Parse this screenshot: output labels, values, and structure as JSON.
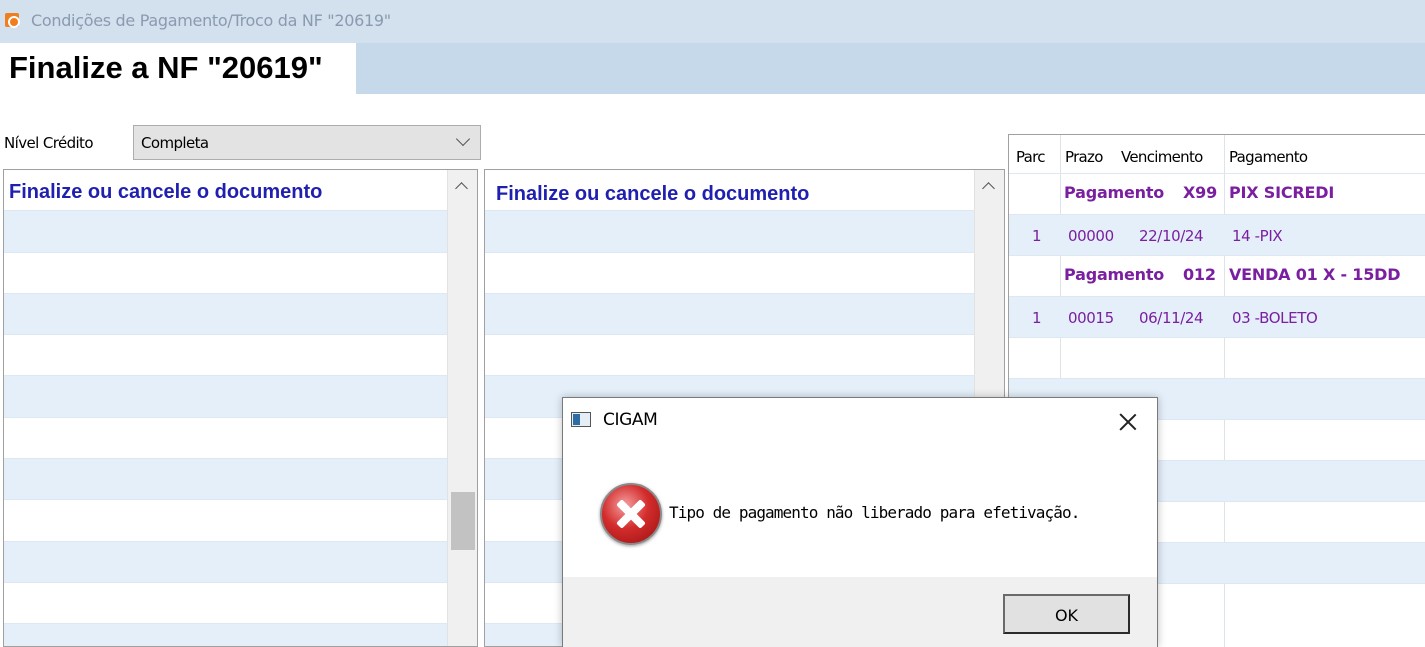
{
  "window": {
    "title": "Condições de Pagamento/Troco da NF \"20619\"",
    "icon": "app-icon"
  },
  "header": {
    "title": "Finalize a NF \"20619\""
  },
  "nivel_credito": {
    "label": "Nível Crédito",
    "value": "Completa"
  },
  "left_panel": {
    "heading": "Finalize ou cancele o documento"
  },
  "middle_panel": {
    "heading": "Finalize ou cancele o documento"
  },
  "parcelas": {
    "columns": [
      "Parc",
      "Prazo",
      "Vencimento",
      "Pagamento"
    ],
    "groups": [
      {
        "label": "Pagamento",
        "code": "X99",
        "name": "PIX SICREDI",
        "rows": [
          {
            "parc": "1",
            "prazo": "00000",
            "vencimento": "22/10/24",
            "pagamento": "14 -PIX"
          }
        ]
      },
      {
        "label": "Pagamento",
        "code": "012",
        "name": "VENDA 01 X - 15DD",
        "rows": [
          {
            "parc": "1",
            "prazo": "00015",
            "vencimento": "06/11/24",
            "pagamento": "03 -BOLETO"
          }
        ]
      }
    ]
  },
  "dialog": {
    "title": "CIGAM",
    "message": "Tipo de pagamento não liberado para efetivação.",
    "ok_label": "OK",
    "icon": "error-icon"
  },
  "colors": {
    "heading_blue": "#1f1fb0",
    "grid_purple": "#7a1fa0",
    "stripe": "#e4effa",
    "header_band": "#c5d9ea"
  }
}
